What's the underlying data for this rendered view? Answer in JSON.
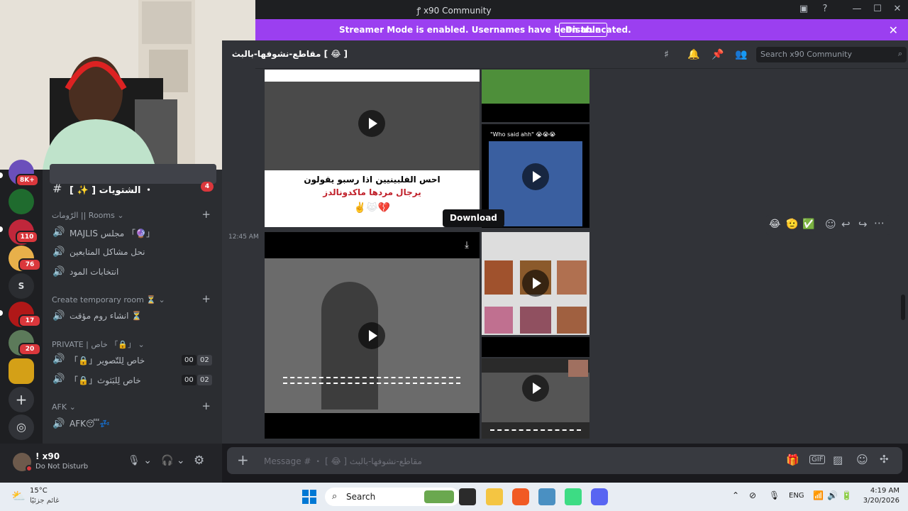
{
  "window": {
    "title": "x90 Community",
    "controls": [
      "minimize",
      "maximize",
      "close"
    ]
  },
  "banner": {
    "text": "Streamer Mode is enabled. Usernames have been truncated.",
    "button": "Disable"
  },
  "channel_header": {
    "name": "[ 😂 ] مقاطع-نشوفها-بالبث",
    "search_placeholder": "Search x90 Community"
  },
  "servers": [
    {
      "badge": "8K+",
      "color": "#6b4fbb"
    },
    {
      "badge": "",
      "color": "#1f6b2e"
    },
    {
      "badge": "110",
      "color": "#c0273b"
    },
    {
      "badge": "76",
      "color": "#e8b04a"
    },
    {
      "label": "S",
      "badge": "",
      "color": "#2b2d31"
    },
    {
      "badge": "17",
      "color": "#b01818"
    },
    {
      "badge": "20",
      "color": "#5c7a5a"
    },
    {
      "badge": "",
      "color": "#d4a017"
    }
  ],
  "sidebar": {
    "top_channel": {
      "name": "[ ✨ ] الشتويات ・",
      "badge": "4"
    },
    "rooms_category": "الرّومات || Rooms",
    "rooms": [
      "MAJLIS مجلس 「🔮」",
      "نحل مشاكل المتابعين",
      "انتخابات المود"
    ],
    "temp_category": "Create temporary room ⏳",
    "temp_rooms": [
      "انشاء روم مؤقت ⏳"
    ],
    "private_category": "PRIVATE | خاص 「🔒」",
    "private_rooms": [
      {
        "name": "「🔒」خاص لِلتّصوير",
        "count_a": "00",
        "count_b": "02"
      },
      {
        "name": "「🔒」خاص لِلبَثوث",
        "count_a": "00",
        "count_b": "02"
      }
    ],
    "afk_category": "AFK",
    "afk_rooms": [
      "AFK😴💤"
    ]
  },
  "user": {
    "name": "! x90",
    "status": "Do Not Disturb"
  },
  "messages": {
    "timestamp": "12:45 AM",
    "tooltip": "Download",
    "video_caption_1": "احس الفلبينيين اذا رسبو يقولون",
    "video_caption_2": "يرجال مردها ماكدونالدز",
    "video_emoji": "✌️😹💔",
    "who_said": "\"Who said ahh\" 😭😭😭",
    "reactions": [
      "😂",
      "🫡",
      "✅"
    ]
  },
  "composer": {
    "placeholder": "Message # ・ [ 😂 ] مقاطع-نشوفها-بالبث"
  },
  "taskbar": {
    "weather_temp": "15°C",
    "weather_desc": "غائم جزئيًا",
    "search": "Search",
    "lang": "ENG",
    "time": "4:19 AM",
    "date": "3/20/2026"
  },
  "colors": {
    "accent": "#9b3ff0",
    "danger": "#da373c",
    "background": "#313338"
  }
}
